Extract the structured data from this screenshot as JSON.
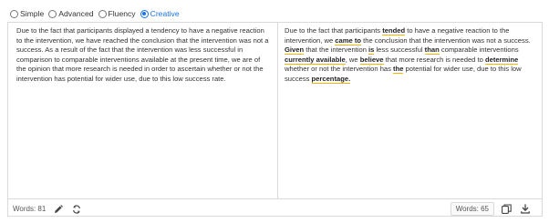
{
  "modes": [
    {
      "label": "Simple",
      "active": false
    },
    {
      "label": "Advanced",
      "active": false
    },
    {
      "label": "Fluency",
      "active": false
    },
    {
      "label": "Creative",
      "active": true
    }
  ],
  "input": {
    "text": "Due to the fact that participants displayed a tendency to have a negative reaction to the intervention, we have reached the conclusion that the intervention was not a success. As a result of the fact that the intervention was less successful in comparison to comparable interventions available at the present time, we are of the opinion that more research is needed in order to ascertain whether or not the intervention has potential for wider use, due to this low success rate.",
    "word_count": "Words: 81"
  },
  "output": {
    "segments": [
      {
        "text": "Due to the fact that participants ",
        "changed": false
      },
      {
        "text": "tended",
        "changed": true
      },
      {
        "text": " to have a negative reaction to the intervention, we ",
        "changed": false
      },
      {
        "text": "came to",
        "changed": true
      },
      {
        "text": " the conclusion that the intervention was not a success. ",
        "changed": false
      },
      {
        "text": "Given",
        "changed": true
      },
      {
        "text": " that the intervention ",
        "changed": false
      },
      {
        "text": "is",
        "changed": true
      },
      {
        "text": " less successful ",
        "changed": false
      },
      {
        "text": "than",
        "changed": true
      },
      {
        "text": " comparable interventions ",
        "changed": false
      },
      {
        "text": "currently available",
        "changed": true
      },
      {
        "text": ", we ",
        "changed": false
      },
      {
        "text": "believe",
        "changed": true
      },
      {
        "text": " that more research is needed to ",
        "changed": false
      },
      {
        "text": "determine",
        "changed": true
      },
      {
        "text": " whether or not the intervention has ",
        "changed": false
      },
      {
        "text": "the",
        "changed": true
      },
      {
        "text": " potential for wider use, due to this low success ",
        "changed": false
      },
      {
        "text": "percentage.",
        "changed": true
      }
    ],
    "word_count": "Words: 65"
  },
  "icons": {
    "edit": "pencil-icon",
    "refresh": "refresh-icon",
    "copy": "copy-icon",
    "download": "download-icon"
  },
  "colors": {
    "accent": "#1a73e8",
    "highlight_underline": "#f4b400",
    "border": "#d9d9d9"
  }
}
